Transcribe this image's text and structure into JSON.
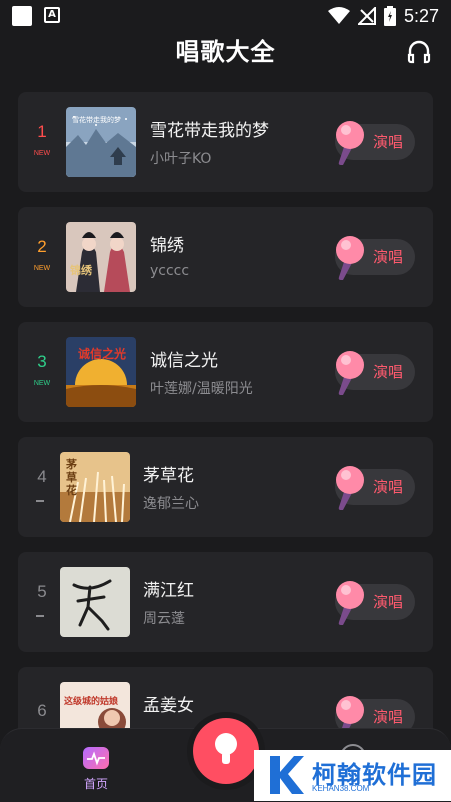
{
  "status_bar": {
    "time": "5:27",
    "left_badge": "A"
  },
  "header": {
    "title": "唱歌大全"
  },
  "songs": [
    {
      "rank": "1",
      "tag": "NEW",
      "rank_color": "#ff4d4d",
      "title": "雪花带走我的梦",
      "artist": "小叶子KO",
      "cover_text": "雪花带走我的梦",
      "sing_label": "演唱"
    },
    {
      "rank": "2",
      "tag": "NEW",
      "rank_color": "#ff9f2e",
      "title": "锦绣",
      "artist": "ycccc",
      "cover_text": "锦绣",
      "sing_label": "演唱"
    },
    {
      "rank": "3",
      "tag": "NEW",
      "rank_color": "#2fcf8a",
      "title": "诚信之光",
      "artist": "叶莲娜/温暖阳光",
      "cover_text": "诚信之光",
      "sing_label": "演唱"
    },
    {
      "rank": "4",
      "tag": "",
      "rank_color": "#8a8a8e",
      "title": "茅草花",
      "artist": "逸郁兰心",
      "cover_text": "茅草花",
      "sing_label": "演唱"
    },
    {
      "rank": "5",
      "tag": "",
      "rank_color": "#8a8a8e",
      "title": "满江红",
      "artist": "周云蓬",
      "cover_text": "",
      "sing_label": "演唱"
    },
    {
      "rank": "6",
      "tag": "",
      "rank_color": "#8a8a8e",
      "title": "孟姜女",
      "artist": "",
      "cover_text": "这级城的姑娘",
      "sing_label": "演唱"
    }
  ],
  "bottom_nav": {
    "home_label": "首页"
  },
  "watermark": {
    "text": "柯翰软件园",
    "url": "KEHAN38.COM"
  },
  "colors": {
    "accent": "#ff4e62",
    "card": "#252528",
    "background": "#1b1b1d"
  }
}
